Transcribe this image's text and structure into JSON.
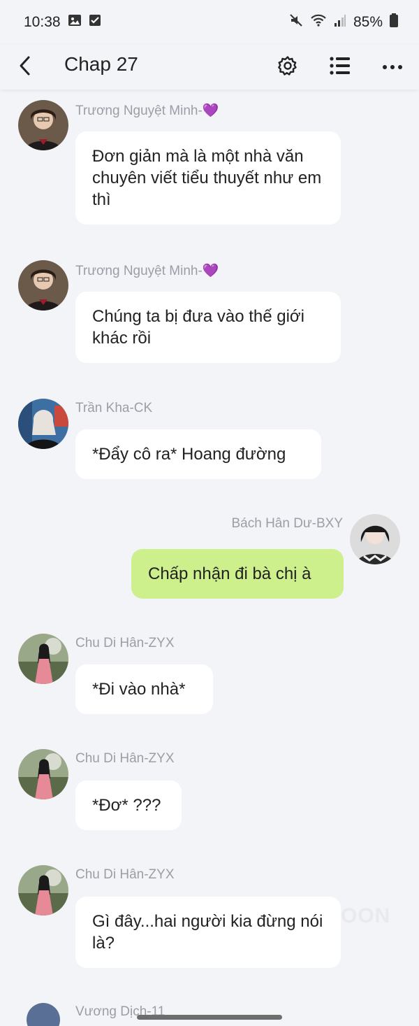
{
  "status": {
    "time": "10:38",
    "battery": "85%"
  },
  "header": {
    "title": "Chap 27"
  },
  "messages": [
    {
      "author": "Trương Nguyệt Minh-💜",
      "text": "Đơn giản mà là một nhà văn chuyên viết tiểu thuyết như em thì",
      "side": "left"
    },
    {
      "author": "Trương Nguyệt Minh-💜",
      "text": "Chúng ta bị đưa vào thế giới khác rồi",
      "side": "left"
    },
    {
      "author": "Trần Kha-CK",
      "text": "*Đẩy cô ra* Hoang đường",
      "side": "left"
    },
    {
      "author": "Bách Hân Dư-BXY",
      "text": "Chấp nhận đi bà chị à",
      "side": "right"
    },
    {
      "author": "Chu Di Hân-ZYX",
      "text": "*Đi vào nhà*",
      "side": "left"
    },
    {
      "author": "Chu Di Hân-ZYX",
      "text": "*Đơ* ???",
      "side": "left"
    },
    {
      "author": "Chu Di Hân-ZYX",
      "text": "Gì đây...hai người kia đừng nói là?",
      "side": "left"
    }
  ],
  "partial_next": {
    "author": "Vương Dịch-11"
  },
  "watermark": "OON",
  "colors": {
    "background": "#f3f4f8",
    "bubble": "#ffffff",
    "my_bubble": "#cdef8c",
    "author": "#9a9ea6"
  }
}
